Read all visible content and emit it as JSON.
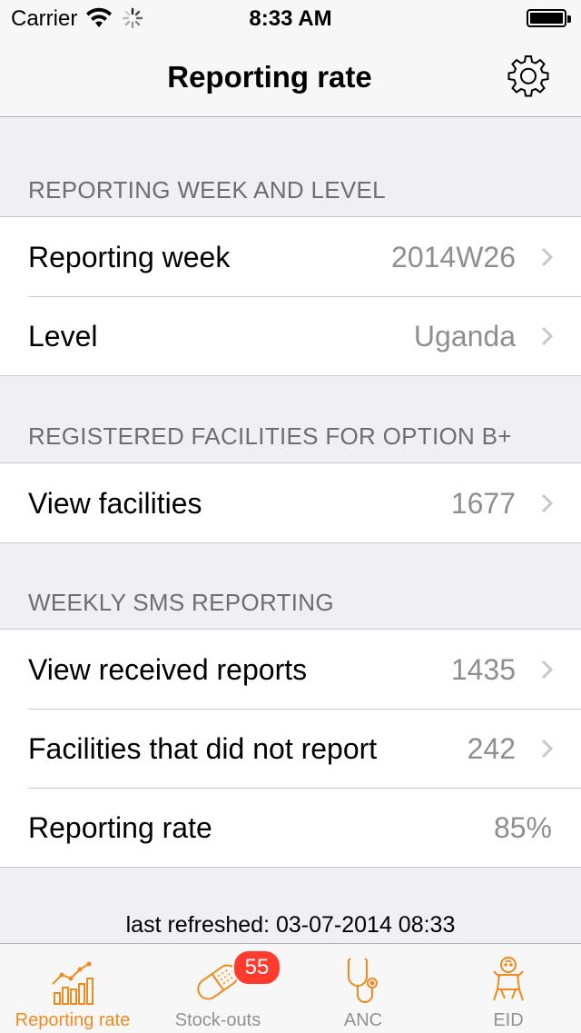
{
  "status_bar": {
    "carrier": "Carrier",
    "time": "8:33 AM",
    "icons": [
      "wifi-icon",
      "activity-spinner-icon",
      "battery-icon"
    ]
  },
  "nav": {
    "title": "Reporting rate",
    "settings_icon": "gear-icon"
  },
  "sections": [
    {
      "header": "REPORTING WEEK AND LEVEL",
      "rows": [
        {
          "label": "Reporting week",
          "value": "2014W26",
          "disclosure": true
        },
        {
          "label": "Level",
          "value": "Uganda",
          "disclosure": true
        }
      ]
    },
    {
      "header": "REGISTERED FACILITIES FOR OPTION B+",
      "rows": [
        {
          "label": "View facilities",
          "value": "1677",
          "disclosure": true
        }
      ]
    },
    {
      "header": "WEEKLY SMS REPORTING",
      "rows": [
        {
          "label": "View received reports",
          "value": "1435",
          "disclosure": true
        },
        {
          "label": "Facilities that did not report",
          "value": "242",
          "disclosure": true
        },
        {
          "label": "Reporting rate",
          "value": "85%",
          "disclosure": false
        }
      ]
    }
  ],
  "footer": {
    "last_refreshed": "last refreshed: 03-07-2014 08:33"
  },
  "tab_bar": {
    "accent_color": "#f08a1d",
    "inactive_color": "#929292",
    "badge_color": "#ff3b30",
    "tabs": [
      {
        "label": "Reporting rate",
        "icon": "bar-chart-icon",
        "active": true
      },
      {
        "label": "Stock-outs",
        "icon": "pill-icon",
        "active": false,
        "badge": "55"
      },
      {
        "label": "ANC",
        "icon": "stethoscope-icon",
        "active": false
      },
      {
        "label": "EID",
        "icon": "baby-icon",
        "active": false
      }
    ]
  }
}
